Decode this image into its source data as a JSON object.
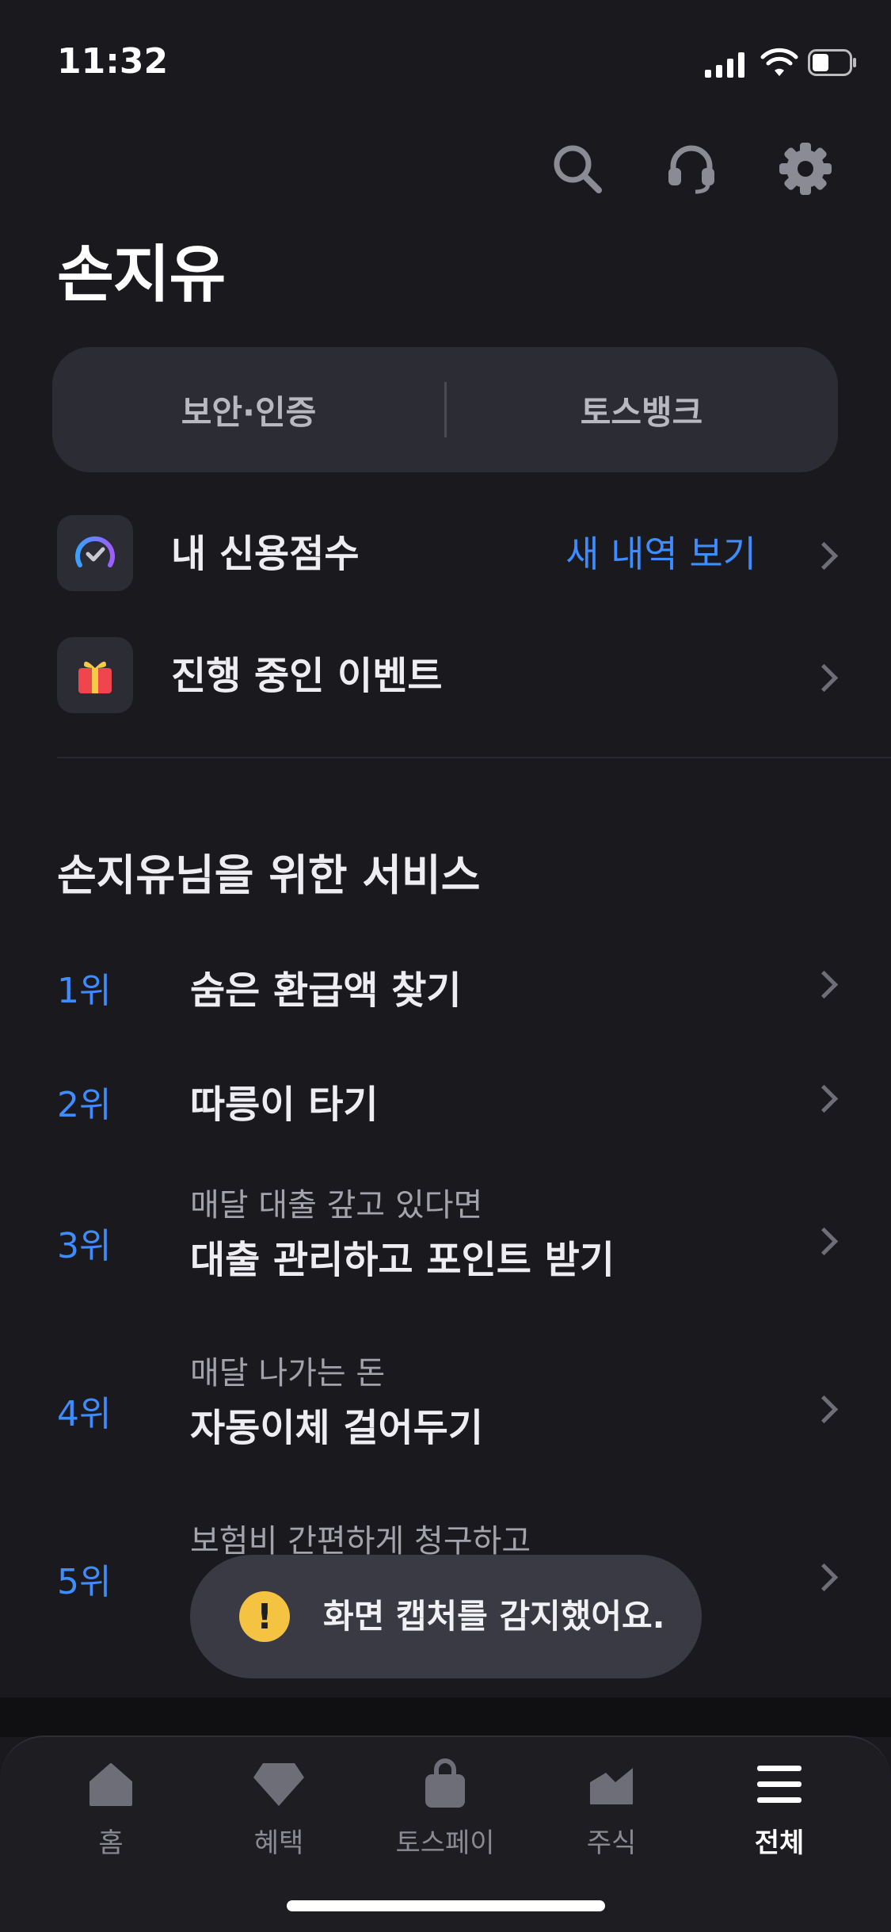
{
  "status_bar": {
    "time": "11:32"
  },
  "header": {
    "icons": [
      "search-icon",
      "headset-icon",
      "gear-icon"
    ],
    "user_name": "손지유"
  },
  "segment": {
    "left_label": "보안·인증",
    "right_label": "토스뱅크"
  },
  "quick_rows": [
    {
      "label": "내 신용점수",
      "link": "새 내역 보기",
      "icon": "credit-gauge-icon"
    },
    {
      "label": "진행 중인 이벤트",
      "icon": "gift-icon"
    }
  ],
  "services": {
    "title": "손지유님을 위한 서비스",
    "items": [
      {
        "rank": "1위",
        "main": "숨은 환급액 찾기"
      },
      {
        "rank": "2위",
        "main": "따릉이 타기"
      },
      {
        "rank": "3위",
        "sub": "매달 대출 갚고 있다면",
        "main": "대출 관리하고 포인트 받기"
      },
      {
        "rank": "4위",
        "sub": "매달 나가는 돈",
        "main": "자동이체 걸어두기"
      },
      {
        "rank": "5위",
        "sub": "보험비 간편하게 청구하고"
      }
    ]
  },
  "toast": {
    "message": "화면 캡처를 감지했어요.",
    "icon": "warning-icon"
  },
  "tabbar": {
    "items": [
      {
        "label": "홈",
        "icon": "home-icon"
      },
      {
        "label": "혜택",
        "icon": "diamond-icon"
      },
      {
        "label": "토스페이",
        "icon": "shopping-bag-icon"
      },
      {
        "label": "주식",
        "icon": "stock-chart-icon"
      },
      {
        "label": "전체",
        "icon": "menu-icon",
        "active": true
      }
    ]
  },
  "colors": {
    "background": "#19191e",
    "accent": "#3f8cff",
    "card": "#2c2c35",
    "toast": "#3a3a44",
    "warning": "#f5c342"
  }
}
